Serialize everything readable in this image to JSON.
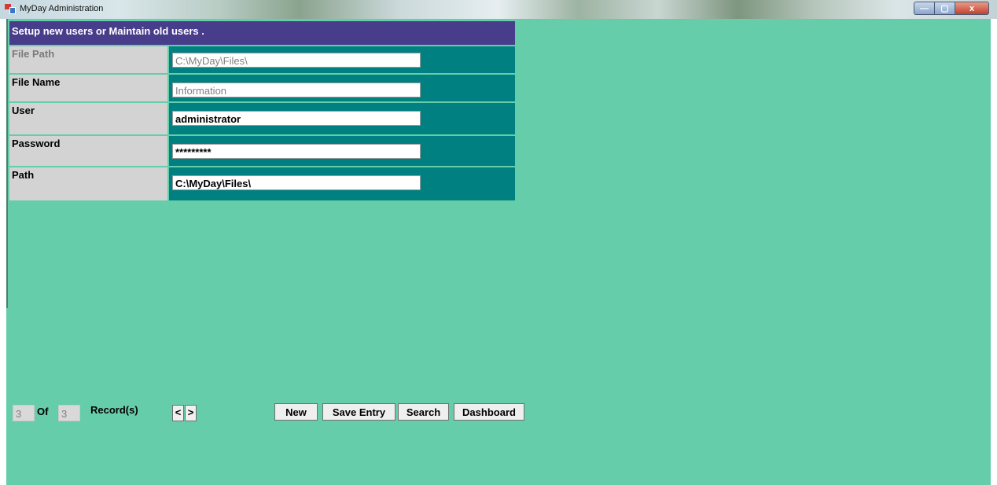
{
  "window": {
    "title": "MyDay Administration",
    "controls": {
      "minimize": "—",
      "maximize": "▢",
      "close": "x"
    }
  },
  "form": {
    "header": "Setup new users or Maintain old users .",
    "fields": [
      {
        "label": "File Path",
        "value": "C:\\MyDay\\Files\\"
      },
      {
        "label": "File Name",
        "value": "Information"
      },
      {
        "label": "User",
        "value": "administrator"
      },
      {
        "label": "Password",
        "value": "*********"
      },
      {
        "label": "Path",
        "value": "C:\\MyDay\\Files\\"
      }
    ]
  },
  "navigation": {
    "current_record": "3",
    "of_label": "Of",
    "total_records": "3",
    "records_label": "Record(s)",
    "prev_label": "<",
    "next_label": ">"
  },
  "buttons": {
    "new": "New",
    "save": "Save Entry",
    "search": "Search",
    "dashboard": "Dashboard"
  },
  "colors": {
    "background": "#66cdaa",
    "header": "#483d8b",
    "field_panel": "#008080",
    "label_panel": "#d3d3d3"
  }
}
